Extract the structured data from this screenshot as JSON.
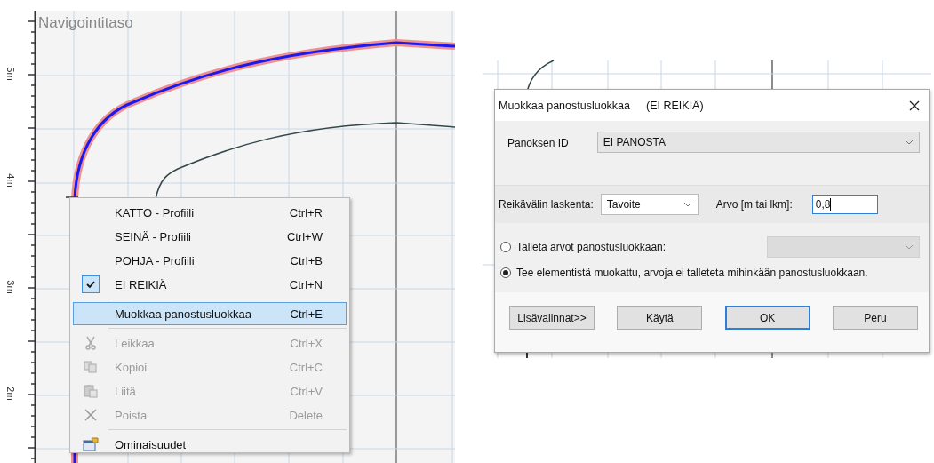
{
  "canvas": {
    "title": "Navigointitaso",
    "axis_labels": [
      "5m",
      "4m",
      "3m",
      "2m"
    ]
  },
  "context_menu": {
    "items": [
      {
        "kind": "item",
        "label": "KATTO - Profiili",
        "shortcut": "Ctrl+R",
        "checked": false,
        "disabled": false,
        "selected": false
      },
      {
        "kind": "item",
        "label": "SEINÄ - Profiili",
        "shortcut": "Ctrl+W",
        "checked": false,
        "disabled": false,
        "selected": false
      },
      {
        "kind": "item",
        "label": "POHJA - Profiili",
        "shortcut": "Ctrl+B",
        "checked": false,
        "disabled": false,
        "selected": false
      },
      {
        "kind": "item",
        "label": "EI REIKIÄ",
        "shortcut": "Ctrl+N",
        "checked": true,
        "disabled": false,
        "selected": false
      },
      {
        "kind": "separator"
      },
      {
        "kind": "item",
        "label": "Muokkaa panostusluokkaa",
        "shortcut": "Ctrl+E",
        "checked": false,
        "disabled": false,
        "selected": true
      },
      {
        "kind": "separator"
      },
      {
        "kind": "item",
        "label": "Leikkaa",
        "shortcut": "Ctrl+X",
        "checked": false,
        "disabled": true,
        "selected": false
      },
      {
        "kind": "item",
        "label": "Kopioi",
        "shortcut": "Ctrl+C",
        "checked": false,
        "disabled": true,
        "selected": false
      },
      {
        "kind": "item",
        "label": "Liitä",
        "shortcut": "Ctrl+V",
        "checked": false,
        "disabled": true,
        "selected": false
      },
      {
        "kind": "item",
        "label": "Poista",
        "shortcut": "Delete",
        "checked": false,
        "disabled": true,
        "selected": false
      },
      {
        "kind": "separator"
      },
      {
        "kind": "item",
        "label": "Ominaisuudet",
        "checked": false,
        "disabled": false,
        "selected": false
      }
    ]
  },
  "dialog": {
    "title": "Muokkaa panostusluokkaa",
    "subtitle": "(EI REIKIÄ)",
    "charge_id": {
      "label": "Panoksen ID",
      "value": "EI PANOSTA"
    },
    "spacing": {
      "label": "Reikävälin laskenta:",
      "value": "Tavoite"
    },
    "amount": {
      "label": "Arvo [m tai lkm]:",
      "value": "0,8"
    },
    "options": [
      {
        "label": "Talleta arvot panostusluokkaan:",
        "selected": false,
        "combo": {
          "disabled": true
        }
      },
      {
        "label": "Tee elementistä muokattu, arvoja ei talleteta mihinkään panostusluokkaan.",
        "selected": true
      }
    ],
    "buttons": [
      {
        "label": "Lisävalinnat>>",
        "default": false
      },
      {
        "label": "Käytä",
        "default": false
      },
      {
        "label": "OK",
        "default": true
      },
      {
        "label": "Peru",
        "default": false
      }
    ]
  }
}
